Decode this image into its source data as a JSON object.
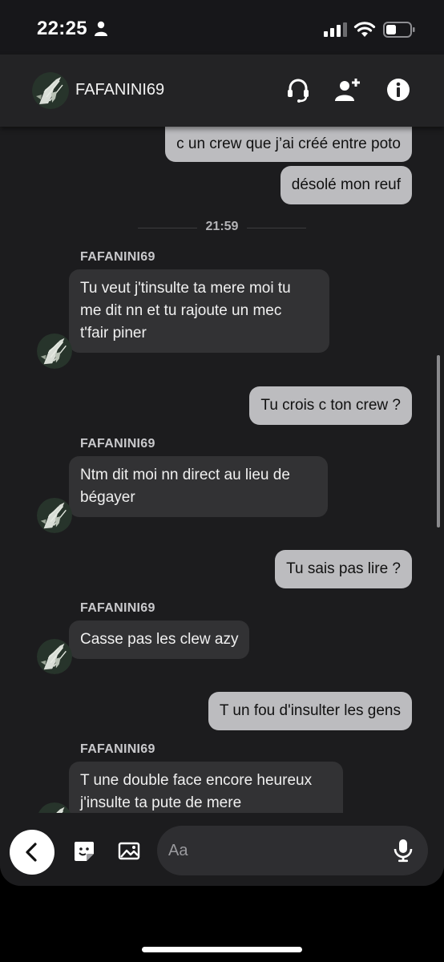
{
  "status_bar": {
    "time": "22:25",
    "icons": [
      "person-icon",
      "cellular-signal-icon",
      "wifi-icon",
      "battery-icon"
    ]
  },
  "header": {
    "contact_name": "FAFANINI69",
    "icons": [
      "headset-icon",
      "add-friend-icon",
      "info-icon"
    ]
  },
  "chat": {
    "messages": [
      {
        "type": "sent",
        "text": "c un crew que j’ai créé entre poto"
      },
      {
        "type": "sent",
        "text": "désolé mon reuf"
      },
      {
        "type": "separator",
        "text": "21:59"
      },
      {
        "type": "received",
        "sender": "FAFANINI69",
        "lines": [
          "Tu veut j'tinsulte ta mere moi tu",
          "me dit nn et tu rajoute un mec",
          "t'fair piner"
        ]
      },
      {
        "type": "sent",
        "text": "Tu crois c ton crew ?"
      },
      {
        "type": "received",
        "sender": "FAFANINI69",
        "lines": [
          "Ntm dit moi nn direct au lieu de",
          "bégayer"
        ]
      },
      {
        "type": "sent",
        "text": "Tu sais pas lire ?"
      },
      {
        "type": "received",
        "sender": "FAFANINI69",
        "lines": [
          "Casse pas les clew azy"
        ]
      },
      {
        "type": "sent",
        "text": "T un fou d'insulter les gens"
      },
      {
        "type": "received",
        "sender": "FAFANINI69",
        "lines": [
          "T une double face encore heureux",
          "j'insulte ta pute de mere"
        ]
      }
    ]
  },
  "input_bar": {
    "placeholder": "Aa",
    "icons": [
      "back-chevron-icon",
      "sticker-icon",
      "image-icon",
      "microphone-icon"
    ]
  },
  "colors": {
    "background": "#1c1c1e",
    "sent_bubble": "#bcbcbf",
    "received_bubble": "#323234",
    "header": "#232325"
  }
}
